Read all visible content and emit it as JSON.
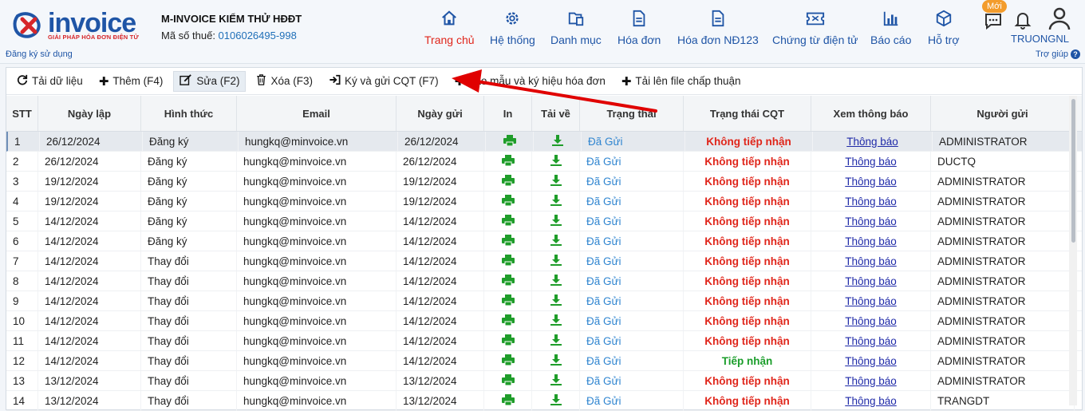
{
  "brand": {
    "logo_text": "invoice",
    "logo_subtitle": "GIẢI PHÁP HÓA ĐƠN ĐIỆN TỬ",
    "register_link": "Đăng ký sử dụng",
    "primary_color": "#1f55a6",
    "accent_color": "#d6262a"
  },
  "company": {
    "name": "M-INVOICE KIỂM THỬ HĐĐT",
    "tax_label": "Mã số thuế: ",
    "tax_code": "0106026495-998"
  },
  "nav": [
    {
      "label": "Trang chủ",
      "icon": "home-icon",
      "active": true
    },
    {
      "label": "Hệ thống",
      "icon": "gear-icon"
    },
    {
      "label": "Danh mục",
      "icon": "folder-icon"
    },
    {
      "label": "Hóa đơn",
      "icon": "document-icon"
    },
    {
      "label": "Hóa đơn NĐ123",
      "icon": "document-icon"
    },
    {
      "label": "Chứng từ điện tử",
      "icon": "ticket-icon"
    },
    {
      "label": "Báo cáo",
      "icon": "bar-chart-icon"
    },
    {
      "label": "Hỗ trợ",
      "icon": "cube-icon"
    }
  ],
  "user": {
    "new_badge": "Mới",
    "name": "TRUONGNL",
    "help": "Trợ giúp"
  },
  "toolbar": {
    "reload": "Tải dữ liệu",
    "add": "Thêm (F4)",
    "edit": "Sửa (F2)",
    "delete": "Xóa (F3)",
    "sign_send": "Ký và gửi CQT (F7)",
    "create_template": "Tạo mẫu và ký hiệu hóa đơn",
    "upload": "Tải lên file chấp thuận"
  },
  "table": {
    "headers": [
      "STT",
      "Ngày lập",
      "Hình thức",
      "Email",
      "Ngày gửi",
      "In",
      "Tải về",
      "Trạng thái",
      "Trạng thái CQT",
      "Xem thông báo",
      "Người gửi"
    ],
    "rows": [
      {
        "stt": "1",
        "date": "26/12/2024",
        "type": "Đăng ký",
        "email": "hungkq@minvoice.vn",
        "sent": "26/12/2024",
        "status": "Đã Gửi",
        "cqt": "Không tiếp nhận",
        "cqt_ok": false,
        "notice": "Thông báo",
        "sender": "ADMINISTRATOR"
      },
      {
        "stt": "2",
        "date": "26/12/2024",
        "type": "Đăng ký",
        "email": "hungkq@minvoice.vn",
        "sent": "26/12/2024",
        "status": "Đã Gửi",
        "cqt": "Không tiếp nhận",
        "cqt_ok": false,
        "notice": "Thông báo",
        "sender": "DUCTQ"
      },
      {
        "stt": "3",
        "date": "19/12/2024",
        "type": "Đăng ký",
        "email": "hungkq@minvoice.vn",
        "sent": "19/12/2024",
        "status": "Đã Gửi",
        "cqt": "Không tiếp nhận",
        "cqt_ok": false,
        "notice": "Thông báo",
        "sender": "ADMINISTRATOR"
      },
      {
        "stt": "4",
        "date": "19/12/2024",
        "type": "Đăng ký",
        "email": "hungkq@minvoice.vn",
        "sent": "19/12/2024",
        "status": "Đã Gửi",
        "cqt": "Không tiếp nhận",
        "cqt_ok": false,
        "notice": "Thông báo",
        "sender": "ADMINISTRATOR"
      },
      {
        "stt": "5",
        "date": "14/12/2024",
        "type": "Đăng ký",
        "email": "hungkq@minvoice.vn",
        "sent": "14/12/2024",
        "status": "Đã Gửi",
        "cqt": "Không tiếp nhận",
        "cqt_ok": false,
        "notice": "Thông báo",
        "sender": "ADMINISTRATOR"
      },
      {
        "stt": "6",
        "date": "14/12/2024",
        "type": "Đăng ký",
        "email": "hungkq@minvoice.vn",
        "sent": "14/12/2024",
        "status": "Đã Gửi",
        "cqt": "Không tiếp nhận",
        "cqt_ok": false,
        "notice": "Thông báo",
        "sender": "ADMINISTRATOR"
      },
      {
        "stt": "7",
        "date": "14/12/2024",
        "type": "Thay đổi",
        "email": "hungkq@minvoice.vn",
        "sent": "14/12/2024",
        "status": "Đã Gửi",
        "cqt": "Không tiếp nhận",
        "cqt_ok": false,
        "notice": "Thông báo",
        "sender": "ADMINISTRATOR"
      },
      {
        "stt": "8",
        "date": "14/12/2024",
        "type": "Thay đổi",
        "email": "hungkq@minvoice.vn",
        "sent": "14/12/2024",
        "status": "Đã Gửi",
        "cqt": "Không tiếp nhận",
        "cqt_ok": false,
        "notice": "Thông báo",
        "sender": "ADMINISTRATOR"
      },
      {
        "stt": "9",
        "date": "14/12/2024",
        "type": "Thay đổi",
        "email": "hungkq@minvoice.vn",
        "sent": "14/12/2024",
        "status": "Đã Gửi",
        "cqt": "Không tiếp nhận",
        "cqt_ok": false,
        "notice": "Thông báo",
        "sender": "ADMINISTRATOR"
      },
      {
        "stt": "10",
        "date": "14/12/2024",
        "type": "Thay đổi",
        "email": "hungkq@minvoice.vn",
        "sent": "14/12/2024",
        "status": "Đã Gửi",
        "cqt": "Không tiếp nhận",
        "cqt_ok": false,
        "notice": "Thông báo",
        "sender": "ADMINISTRATOR"
      },
      {
        "stt": "11",
        "date": "14/12/2024",
        "type": "Thay đổi",
        "email": "hungkq@minvoice.vn",
        "sent": "14/12/2024",
        "status": "Đã Gửi",
        "cqt": "Không tiếp nhận",
        "cqt_ok": false,
        "notice": "Thông báo",
        "sender": "ADMINISTRATOR"
      },
      {
        "stt": "12",
        "date": "14/12/2024",
        "type": "Thay đổi",
        "email": "hungkq@minvoice.vn",
        "sent": "14/12/2024",
        "status": "Đã Gửi",
        "cqt": "Tiếp nhận",
        "cqt_ok": true,
        "notice": "Thông báo",
        "sender": "ADMINISTRATOR"
      },
      {
        "stt": "13",
        "date": "13/12/2024",
        "type": "Thay đổi",
        "email": "hungkq@minvoice.vn",
        "sent": "13/12/2024",
        "status": "Đã Gửi",
        "cqt": "Không tiếp nhận",
        "cqt_ok": false,
        "notice": "Thông báo",
        "sender": "ADMINISTRATOR"
      },
      {
        "stt": "14",
        "date": "13/12/2024",
        "type": "Thay đổi",
        "email": "hungkq@minvoice.vn",
        "sent": "13/12/2024",
        "status": "Đã Gửi",
        "cqt": "Không tiếp nhận",
        "cqt_ok": false,
        "notice": "Thông báo",
        "sender": "TRANGDT"
      }
    ]
  }
}
